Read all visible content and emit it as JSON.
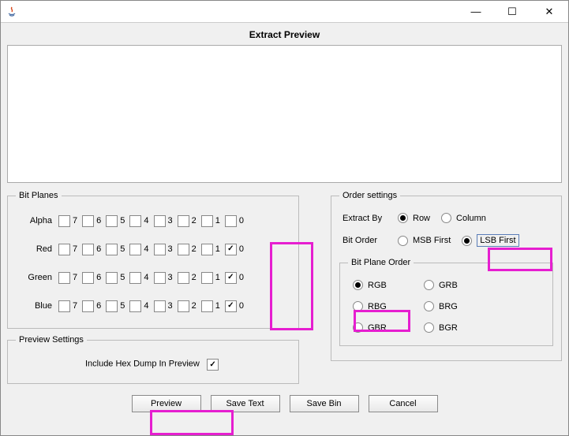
{
  "titlebar": {
    "minimize_glyph": "—",
    "maximize_glyph": "☐",
    "close_glyph": "✕"
  },
  "page_title": "Extract Preview",
  "bit_planes": {
    "legend": "Bit Planes",
    "channels": [
      {
        "name": "Alpha",
        "bits": [
          {
            "v": "7",
            "c": false
          },
          {
            "v": "6",
            "c": false
          },
          {
            "v": "5",
            "c": false
          },
          {
            "v": "4",
            "c": false
          },
          {
            "v": "3",
            "c": false
          },
          {
            "v": "2",
            "c": false
          },
          {
            "v": "1",
            "c": false
          },
          {
            "v": "0",
            "c": false
          }
        ]
      },
      {
        "name": "Red",
        "bits": [
          {
            "v": "7",
            "c": false
          },
          {
            "v": "6",
            "c": false
          },
          {
            "v": "5",
            "c": false
          },
          {
            "v": "4",
            "c": false
          },
          {
            "v": "3",
            "c": false
          },
          {
            "v": "2",
            "c": false
          },
          {
            "v": "1",
            "c": false
          },
          {
            "v": "0",
            "c": true
          }
        ]
      },
      {
        "name": "Green",
        "bits": [
          {
            "v": "7",
            "c": false
          },
          {
            "v": "6",
            "c": false
          },
          {
            "v": "5",
            "c": false
          },
          {
            "v": "4",
            "c": false
          },
          {
            "v": "3",
            "c": false
          },
          {
            "v": "2",
            "c": false
          },
          {
            "v": "1",
            "c": false
          },
          {
            "v": "0",
            "c": true
          }
        ]
      },
      {
        "name": "Blue",
        "bits": [
          {
            "v": "7",
            "c": false
          },
          {
            "v": "6",
            "c": false
          },
          {
            "v": "5",
            "c": false
          },
          {
            "v": "4",
            "c": false
          },
          {
            "v": "3",
            "c": false
          },
          {
            "v": "2",
            "c": false
          },
          {
            "v": "1",
            "c": false
          },
          {
            "v": "0",
            "c": true
          }
        ]
      }
    ]
  },
  "preview_settings": {
    "legend": "Preview Settings",
    "hex_label": "Include Hex Dump In Preview",
    "hex_checked": true
  },
  "order_settings": {
    "legend": "Order settings",
    "extract_by_label": "Extract By",
    "extract_by": {
      "row": "Row",
      "column": "Column",
      "selected": "row"
    },
    "bit_order_label": "Bit Order",
    "bit_order": {
      "msb": "MSB First",
      "lsb": "LSB First",
      "selected": "lsb"
    },
    "bit_plane_order": {
      "legend": "Bit Plane Order",
      "options": [
        "RGB",
        "GRB",
        "RBG",
        "BRG",
        "GBR",
        "BGR"
      ],
      "selected": "RGB"
    }
  },
  "buttons": {
    "preview": "Preview",
    "save_text": "Save Text",
    "save_bin": "Save Bin",
    "cancel": "Cancel"
  }
}
